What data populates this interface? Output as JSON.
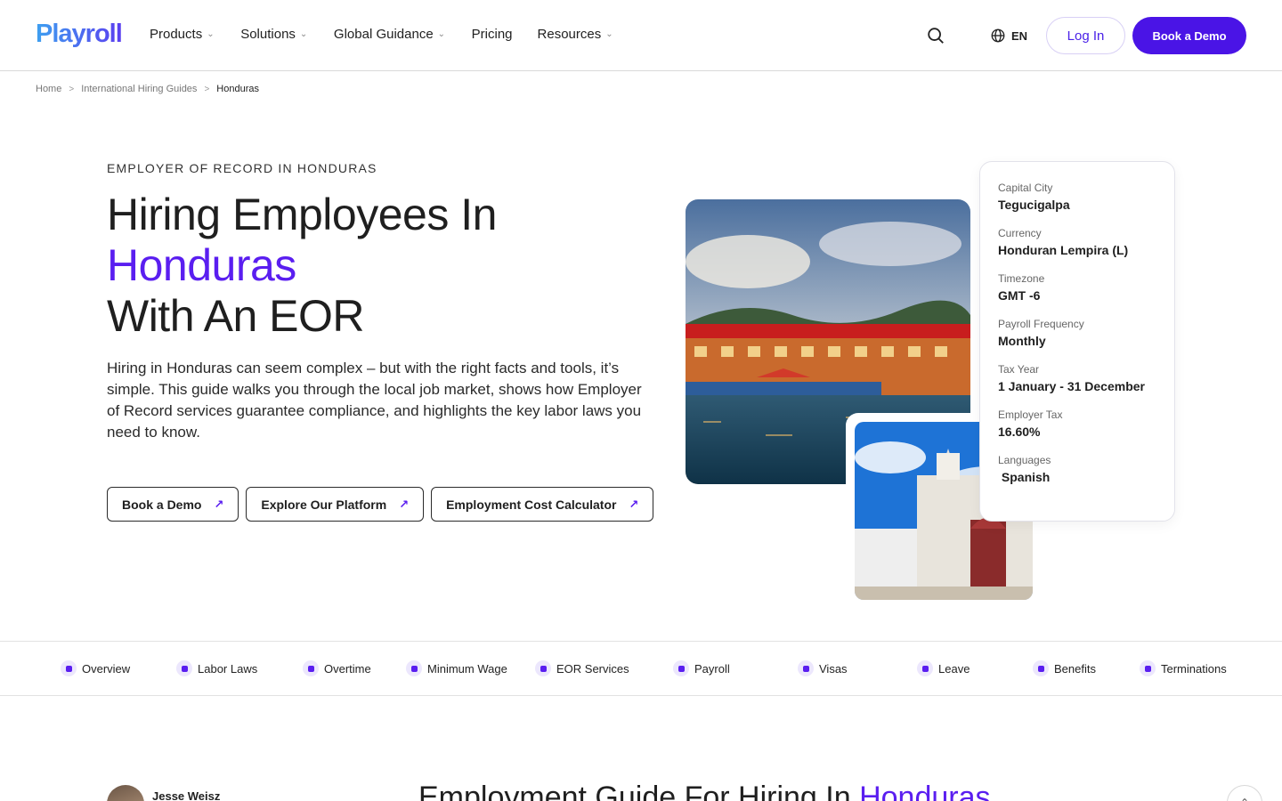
{
  "header": {
    "logo": "Playroll",
    "nav": [
      {
        "label": "Products",
        "has_dropdown": true
      },
      {
        "label": "Solutions",
        "has_dropdown": true
      },
      {
        "label": "Global Guidance",
        "has_dropdown": true
      },
      {
        "label": "Pricing",
        "has_dropdown": false
      },
      {
        "label": "Resources",
        "has_dropdown": true
      }
    ],
    "language": "EN",
    "login_label": "Log In",
    "demo_label": "Book a Demo",
    "icons": {
      "search": "search-icon",
      "language": "globe-icon",
      "dropdown": "chevron-down-icon"
    }
  },
  "breadcrumb": [
    "Home",
    "International Hiring Guides",
    "Honduras"
  ],
  "hero": {
    "eyebrow": "EMPLOYER OF RECORD IN HONDURAS",
    "title_line1": "Hiring Employees In",
    "title_accent": "Honduras",
    "title_line3": "With An EOR",
    "description": "Hiring in Honduras can seem complex – but with the right facts and tools, it’s simple. This guide walks you through the local job market, shows how Employer of Record services guarantee compliance, and highlights the key labor laws you need to know.",
    "ctas": [
      "Book a Demo",
      "Explore Our Platform",
      "Employment Cost Calculator"
    ]
  },
  "facts": [
    {
      "label": "Capital City",
      "value": "Tegucigalpa"
    },
    {
      "label": "Currency",
      "value": "Honduran Lempira (L)"
    },
    {
      "label": "Timezone",
      "value": "GMT -6"
    },
    {
      "label": "Payroll Frequency",
      "value": "Monthly"
    },
    {
      "label": "Tax Year",
      "value": "1 January - 31 December"
    },
    {
      "label": "Employer Tax",
      "value": "16.60%"
    },
    {
      "label": "Languages",
      "value": " Spanish"
    }
  ],
  "tabs": [
    "Overview",
    "Labor Laws",
    "Overtime",
    "Minimum Wage",
    "EOR Services",
    "Payroll",
    "Visas",
    "Leave",
    "Benefits",
    "Terminations"
  ],
  "author": {
    "name": "Jesse Weisz"
  },
  "guide": {
    "title_prefix": "Employment Guide For Hiring In ",
    "title_accent": "Honduras"
  },
  "colors": {
    "accent": "#5a1ef0",
    "brand_button": "#4a14e6"
  }
}
